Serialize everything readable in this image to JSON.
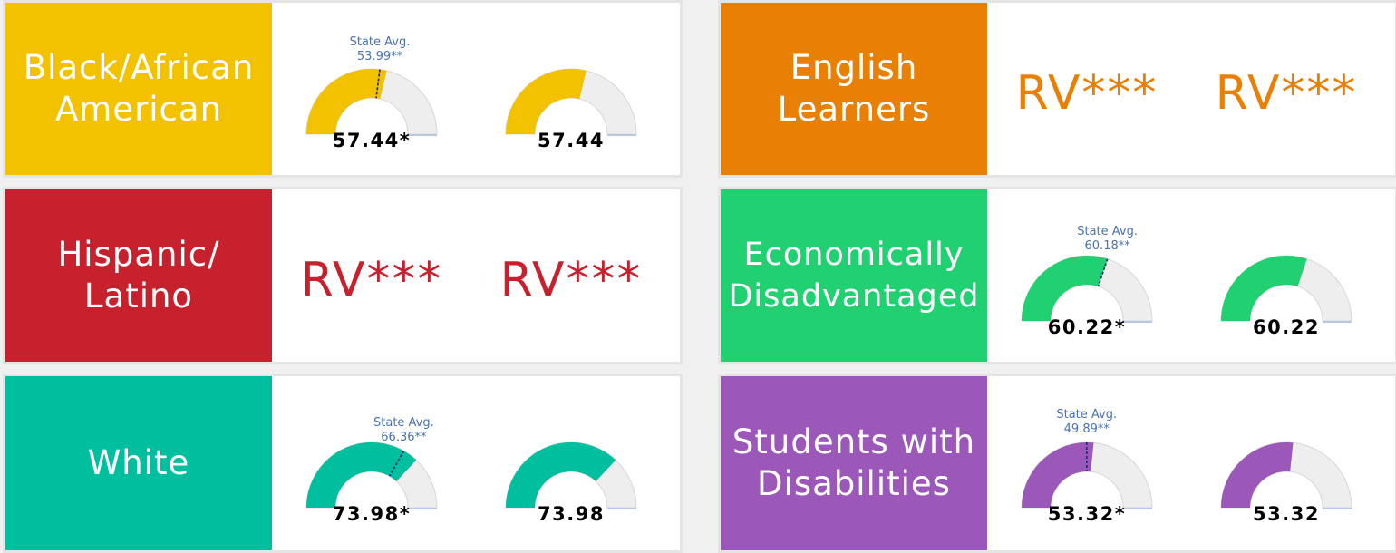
{
  "colors": {
    "black_african_american": "#f2c200",
    "hispanic_latino": "#c8212e",
    "white": "#00bf9f",
    "english_learners": "#e88005",
    "economically_disadvantaged": "#21d070",
    "students_with_disabilities": "#9b58b8",
    "gauge_track": "#eeeeee",
    "state_avg_text": "#4a73b0"
  },
  "state_avg_label": "State Avg.",
  "cards": [
    {
      "group": "Black/African American",
      "label_lines": [
        "Black/African",
        "American"
      ],
      "color": "#f2c200",
      "gauge1": {
        "value": 57.44,
        "value_text": "57.44*",
        "state_avg": 53.99,
        "state_avg_text": "53.99**"
      },
      "gauge2": {
        "value": 57.44,
        "value_text": "57.44"
      }
    },
    {
      "group": "Hispanic/Latino",
      "label_lines": [
        "Hispanic/",
        "Latino"
      ],
      "color": "#c8212e",
      "rv1": "RV***",
      "rv2": "RV***"
    },
    {
      "group": "White",
      "label_lines": [
        "White"
      ],
      "color": "#00bf9f",
      "gauge1": {
        "value": 73.98,
        "value_text": "73.98*",
        "state_avg": 66.36,
        "state_avg_text": "66.36**"
      },
      "gauge2": {
        "value": 73.98,
        "value_text": "73.98"
      }
    },
    {
      "group": "English Learners",
      "label_lines": [
        "English",
        "Learners"
      ],
      "color": "#e88005",
      "rv1": "RV***",
      "rv2": "RV***"
    },
    {
      "group": "Economically Disadvantaged",
      "label_lines": [
        "Economically",
        "Disadvantaged"
      ],
      "color": "#21d070",
      "gauge1": {
        "value": 60.22,
        "value_text": "60.22*",
        "state_avg": 60.18,
        "state_avg_text": "60.18**"
      },
      "gauge2": {
        "value": 60.22,
        "value_text": "60.22"
      }
    },
    {
      "group": "Students with Disabilities",
      "label_lines": [
        "Students with",
        "Disabilities"
      ],
      "color": "#9b58b8",
      "gauge1": {
        "value": 53.32,
        "value_text": "53.32*",
        "state_avg": 49.89,
        "state_avg_text": "49.89**"
      },
      "gauge2": {
        "value": 53.32,
        "value_text": "53.32"
      }
    }
  ]
}
